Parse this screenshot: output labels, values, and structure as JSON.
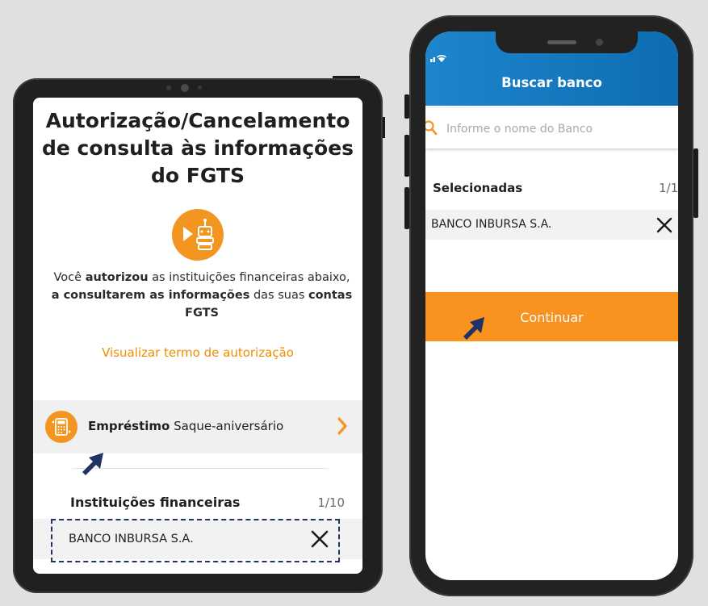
{
  "tablet": {
    "title": "Autorização/Cancelamento\nde consulta às informações\ndo FGTS",
    "desc": {
      "p1": "Você ",
      "b1": "autorizou",
      "p2": " as instituições financeiras abaixo, ",
      "b2": "a consultarem as informações",
      "p3": " das suas ",
      "b3": "contas FGTS"
    },
    "auth_link": "Visualizar termo de autorização",
    "loan": {
      "bold": "Empréstimo",
      "rest": " Saque-aniversário",
      "icon": "loan-calculator-icon"
    },
    "institutions_label": "Instituições financeiras",
    "institutions_count": "1/10",
    "institution_name": "BANCO INBURSA S.A."
  },
  "phone": {
    "header_title": "Buscar banco",
    "search_placeholder": "Informe o nome do Banco",
    "selected_label": "Selecionadas",
    "selected_count": "1/1",
    "selected_name": "BANCO INBURSA S.A.",
    "continue_label": "Continuar"
  },
  "colors": {
    "accent_orange": "#f7931e",
    "link_orange": "#f28c00",
    "header_blue": "#1d86ce",
    "cursor_navy": "#1f3366"
  }
}
